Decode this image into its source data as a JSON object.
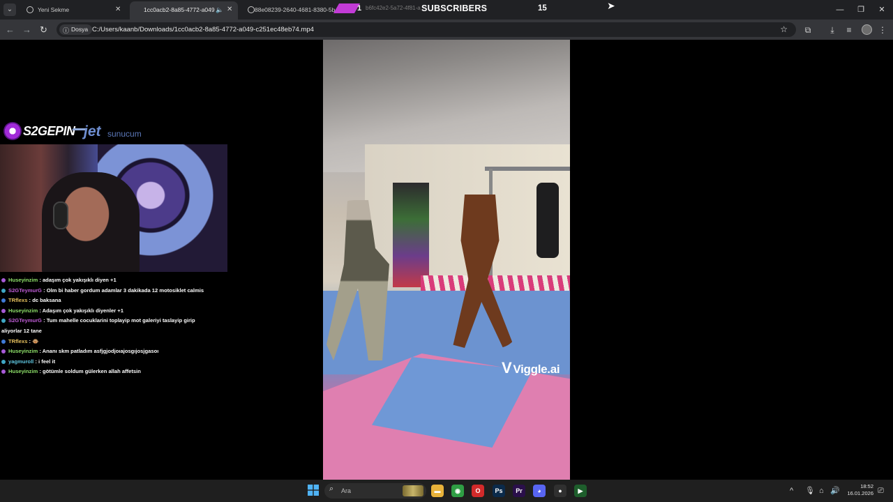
{
  "browser": {
    "tabs": [
      {
        "title": "Yeni Sekme",
        "close": "✕"
      },
      {
        "title": "1cc0acb2-8a85-4772-a049",
        "close": "✕"
      },
      {
        "title": "88e08239-2640-4681-8380-5b",
        "close": ""
      }
    ],
    "overlay": {
      "count_left": "1",
      "ghost_tab": "b6fc42e2-5a72-4f81-a",
      "label": "SUBSCRIBERS",
      "count_right": "15"
    },
    "window_controls": {
      "minimize": "—",
      "maximize": "❐",
      "close": "✕"
    },
    "site_chip": "Dosya",
    "url": "C:/Users/kaanb/Downloads/1cc0acb2-8a85-4772-a049-c251ec48eb74.mp4"
  },
  "stream": {
    "logo_left": "S2GEPIN",
    "logo_right_main": "jet",
    "logo_right_sub": "sunucum",
    "watermark": "Viggle.ai"
  },
  "chat": {
    "messages": [
      {
        "user": "Huseyinzim",
        "user_color": "#8fe26a",
        "badge_color": "#a75ad6",
        "text": "adaşım çok yakışıklı diyen +1"
      },
      {
        "user": "S2GTeymurG",
        "user_color": "#c05dd7",
        "badge_color": "#3fa7c4",
        "text": "Olm bi haber gordum adamlar 3 dakikada 12 motosiklet calmis"
      },
      {
        "user": "TRflexs",
        "user_color": "#e7c25e",
        "badge_color": "#3f7bd6",
        "text": "dc baksana"
      },
      {
        "user": "Huseyinzim",
        "user_color": "#8fe26a",
        "badge_color": "#a75ad6",
        "text": "Adaşım çok yakışıklı diyenler +1"
      },
      {
        "user": "S2GTeymurG",
        "user_color": "#c05dd7",
        "badge_color": "#3fa7c4",
        "text": "Tum mahelle cocuklarini toplayip mot galeriyi taslayip girip"
      },
      {
        "user": "",
        "user_color": "#ffffff",
        "badge_color": "",
        "text": "aliyorlar 12 tane"
      },
      {
        "user": "TRflexs",
        "user_color": "#e7c25e",
        "badge_color": "#3f7bd6",
        "text": "🐵"
      },
      {
        "user": "Huseyinzim",
        "user_color": "#8fe26a",
        "badge_color": "#a75ad6",
        "text": "Ananı skm patladım asfjgjodjoıajosgıjosjgasoı"
      },
      {
        "user": "yagmuroll",
        "user_color": "#5fc7e0",
        "badge_color": "#3fa7c4",
        "text": "i feel it"
      },
      {
        "user": "Huseyinzim",
        "user_color": "#8fe26a",
        "badge_color": "#a75ad6",
        "text": "götümle soldum gülerken allah affetsin"
      }
    ]
  },
  "taskbar": {
    "search_placeholder": "Ara",
    "apps": [
      {
        "icon": "file-explorer-icon",
        "glyph": "▬",
        "bg": "#e8b23a"
      },
      {
        "icon": "chrome-icon",
        "glyph": "◉",
        "bg": "#2f9e44"
      },
      {
        "icon": "opera-icon",
        "glyph": "O",
        "bg": "#d22a2a"
      },
      {
        "icon": "photoshop-icon",
        "glyph": "Ps",
        "bg": "#0b2a4a"
      },
      {
        "icon": "premiere-icon",
        "glyph": "Pr",
        "bg": "#2a0f4a"
      },
      {
        "icon": "discord-icon",
        "glyph": "◕",
        "bg": "#5865f2"
      },
      {
        "icon": "obs-icon",
        "glyph": "●",
        "bg": "#303030"
      },
      {
        "icon": "streaming-app-icon",
        "glyph": "▶",
        "bg": "#1e5e2c"
      }
    ],
    "time": "18:52",
    "date": "16.01.2026"
  }
}
